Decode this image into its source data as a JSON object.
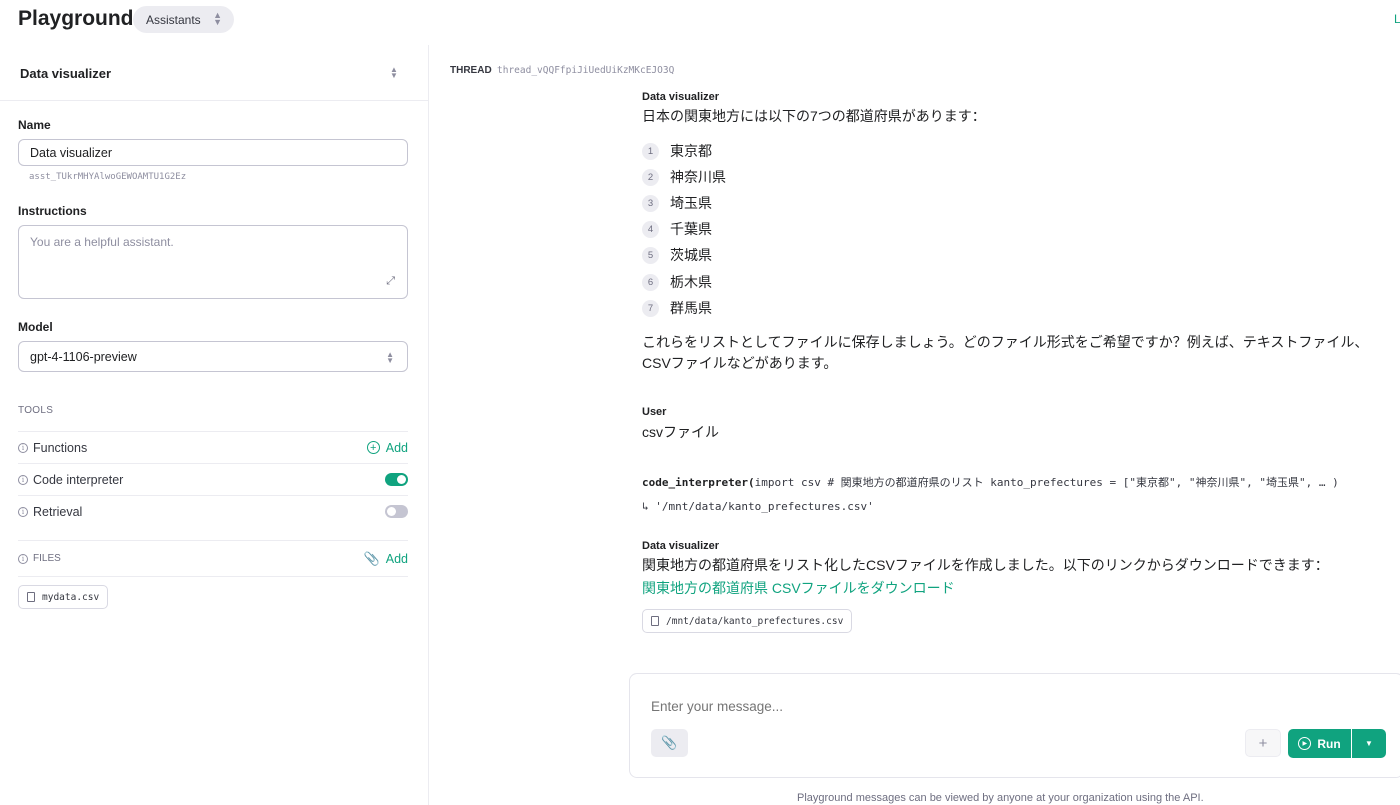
{
  "header": {
    "title": "Playground",
    "mode": "Assistants",
    "right_link": "L"
  },
  "sidebar": {
    "assistant_selector": "Data visualizer",
    "name_label": "Name",
    "name_value": "Data visualizer",
    "assistant_id": "asst_TUkrMHYAlwoGEWOAMTU1G2Ez",
    "instructions_label": "Instructions",
    "instructions_placeholder": "You are a helpful assistant.",
    "model_label": "Model",
    "model_value": "gpt-4-1106-preview",
    "tools_label": "TOOLS",
    "tools": [
      {
        "name": "Functions",
        "action": "Add"
      },
      {
        "name": "Code interpreter",
        "enabled": true
      },
      {
        "name": "Retrieval",
        "enabled": false
      }
    ],
    "files_label": "FILES",
    "files_action": "Add",
    "files": [
      "mydata.csv"
    ]
  },
  "thread": {
    "label": "THREAD",
    "id": "thread_vQQFfpiJiUedUiKzMKcEJO3Q",
    "messages": [
      {
        "role": "Data visualizer",
        "intro": "日本の関東地方には以下の7つの都道府県があります：",
        "list": [
          "東京都",
          "神奈川県",
          "埼玉県",
          "千葉県",
          "茨城県",
          "栃木県",
          "群馬県"
        ],
        "outro_line1": "これらをリストとしてファイルに保存しましょう。どのファイル形式をご希望ですか？例えば、テキストファイル、",
        "outro_line2": "CSVファイルなどがあります。"
      },
      {
        "role": "User",
        "text": "csvファイル"
      },
      {
        "tool_call": "code_interpreter(",
        "tool_code": "import csv # 関東地方の都道府県のリスト kanto_prefectures = [\"東京都\", \"神奈川県\", \"埼玉県\", … )",
        "tool_output": "↳ '/mnt/data/kanto_prefectures.csv'"
      },
      {
        "role": "Data visualizer",
        "text": "関東地方の都道府県をリスト化したCSVファイルを作成しました。以下のリンクからダウンロードできます：",
        "link": "関東地方の都道府県 CSVファイルをダウンロード",
        "attachment": "/mnt/data/kanto_prefectures.csv"
      }
    ]
  },
  "composer": {
    "placeholder": "Enter your message...",
    "run_label": "Run"
  },
  "footer": "Playground messages can be viewed by anyone at your organization using the API.",
  "colors": {
    "accent": "#10a37f",
    "border": "#c5c5d2",
    "muted": "#8e8ea0"
  }
}
